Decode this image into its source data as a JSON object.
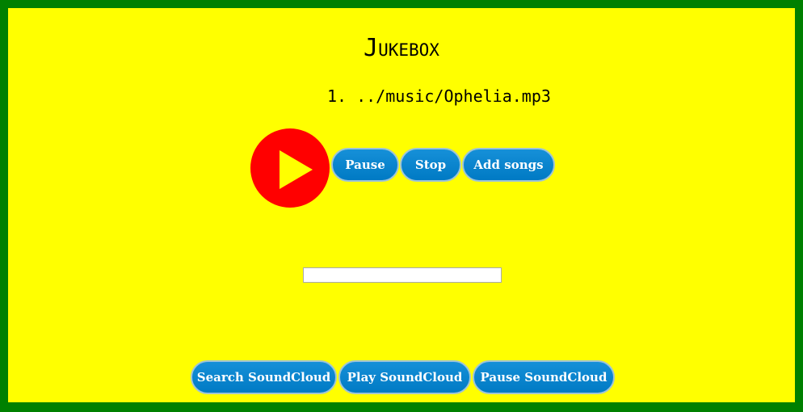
{
  "app": {
    "title": "Jukebox"
  },
  "playlist": {
    "items": [
      {
        "number": "1.",
        "path": "../music/Ophelia.mp3"
      }
    ]
  },
  "controls": {
    "play_icon": "play-icon",
    "pause_label": "Pause",
    "stop_label": "Stop",
    "add_songs_label": "Add songs"
  },
  "search": {
    "value": "",
    "placeholder": ""
  },
  "soundcloud": {
    "search_label": "Search SoundCloud",
    "play_label": "Play SoundCloud",
    "pause_label": "Pause SoundCloud"
  },
  "colors": {
    "background": "#ffff00",
    "border": "#008000",
    "play_button": "#ff0000",
    "button": "#0a85d0",
    "button_text": "#ffffff"
  }
}
